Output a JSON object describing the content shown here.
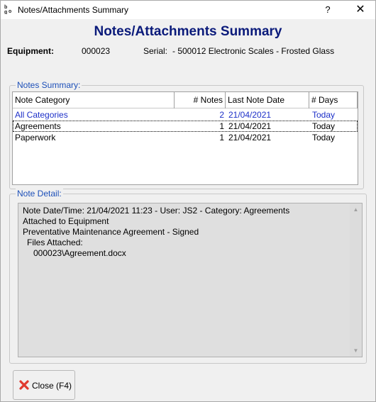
{
  "window": {
    "title": "Notes/Attachments Summary",
    "help": "?",
    "close": "✕"
  },
  "heading": "Notes/Attachments Summary",
  "equipment": {
    "label": "Equipment:",
    "value": "000023",
    "serial_label": "Serial:",
    "serial_value": "- 500012 Electronic Scales - Frosted Glass"
  },
  "notes_summary": {
    "legend": "Notes Summary:",
    "columns": [
      "Note Category",
      "# Notes",
      "Last Note Date",
      "# Days"
    ],
    "rows": [
      {
        "category": "All Categories",
        "notes": "2",
        "last_date": "21/04/2021",
        "days": "Today"
      },
      {
        "category": "Agreements",
        "notes": "1",
        "last_date": "21/04/2021",
        "days": "Today"
      },
      {
        "category": "Paperwork",
        "notes": "1",
        "last_date": "21/04/2021",
        "days": "Today"
      }
    ]
  },
  "note_detail": {
    "legend": "Note Detail:",
    "lines": [
      "Note Date/Time: 21/04/2021 11:23 - User: JS2 - Category: Agreements",
      "Attached to Equipment",
      "Preventative Maintenance Agreement - Signed",
      "Files Attached:",
      "000023\\Agreement.docx"
    ]
  },
  "footer": {
    "close_label": "Close (F4)"
  },
  "colors": {
    "heading": "#0a1a7a",
    "legend": "#1c4fb8",
    "link_row": "#1c2fc8",
    "close_icon": "#e03a2f"
  }
}
